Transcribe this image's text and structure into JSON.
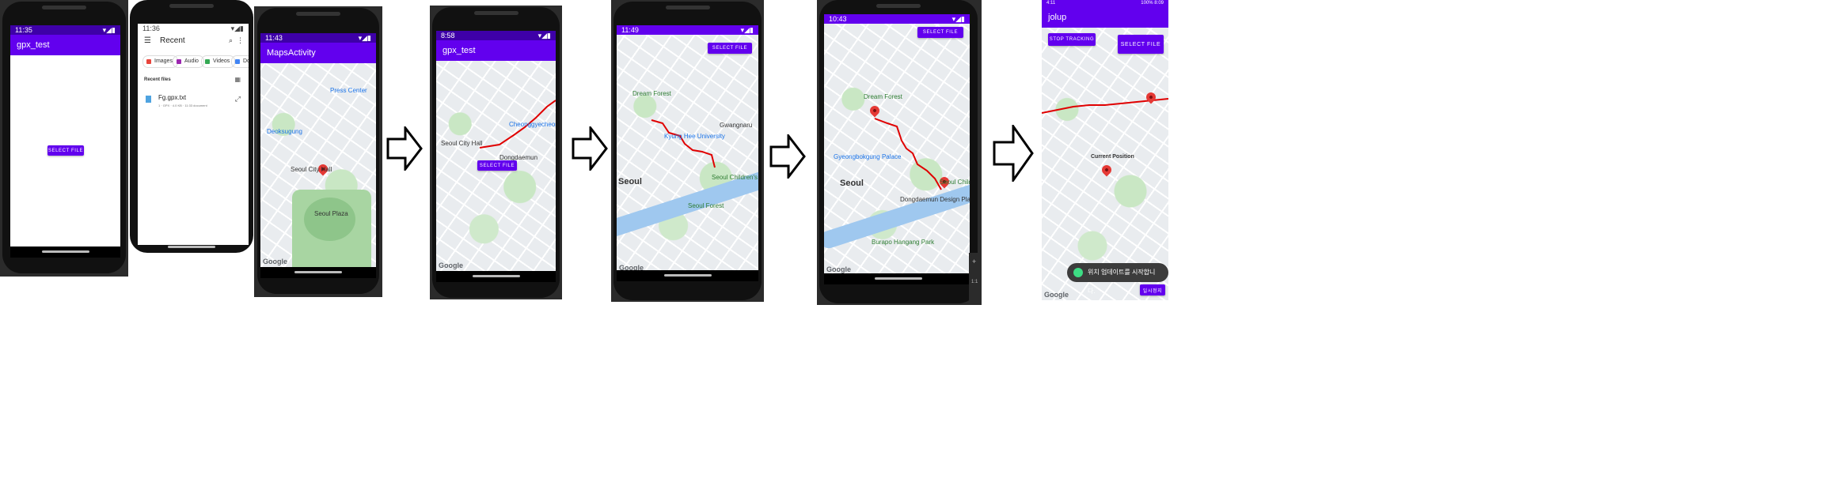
{
  "screen1": {
    "status_time": "11:35",
    "app_title": "gpx_test",
    "select_file_label": "SELECT FILE"
  },
  "screen2": {
    "status_time": "11:36",
    "title": "Recent",
    "chips": [
      {
        "label": "Images",
        "color": "#e8453c"
      },
      {
        "label": "Audio",
        "color": "#9c27b0"
      },
      {
        "label": "Videos",
        "color": "#34a853"
      },
      {
        "label": "Doc",
        "color": "#4285f4"
      }
    ],
    "section_label": "Recent files",
    "file_name": "Fg.gpx.txt",
    "file_meta": "1 · GPX · 4.0 KB · 11:33 document"
  },
  "screen3": {
    "status_time": "11:43",
    "app_title": "MapsActivity",
    "labels": [
      "Seoul City Hall",
      "Seoul Plaza",
      "Press Center",
      "Deoksugung"
    ],
    "google": "Google"
  },
  "screen4": {
    "status_time": "8:58",
    "app_title": "gpx_test",
    "select_file_label": "SELECT FILE",
    "labels": [
      "Cheonggyecheon",
      "Seoul City Hall",
      "Dongdaemun"
    ],
    "google": "Google"
  },
  "screen5": {
    "status_time": "11:49",
    "select_file_label": "SELECT FILE",
    "labels": [
      "Dream Forest",
      "Kyung Hee University",
      "Seoul",
      "Seoul Children's Grand Park",
      "Seoul Forest",
      "Gwangnaru"
    ],
    "google": "Google"
  },
  "screen6": {
    "status_time": "10:43",
    "select_file_label": "SELECT FILE",
    "labels": [
      "Dream Forest",
      "Gyeongbokgung Palace",
      "Seoul",
      "Dongdaemun Design Plaza",
      "Seoul Children's",
      "Burapo Hangang Park"
    ],
    "google": "Google",
    "side_values": [
      "1:1"
    ]
  },
  "screen7": {
    "status_time": "4:11",
    "status_right": "100% 8:09",
    "app_title": "jolup",
    "stop_tracking_label": "STOP TRACKING",
    "select_file_label": "SELECT FILE",
    "current_position_label": "Current Position",
    "toast_text": "위치 업데이트를 시작합니다.",
    "bottom_button_label": "일시정지",
    "google": "Google"
  },
  "colors": {
    "primary": "#6200ee",
    "primary_dark": "#3700b3",
    "route": "#e00000",
    "pin": "#e53935"
  }
}
